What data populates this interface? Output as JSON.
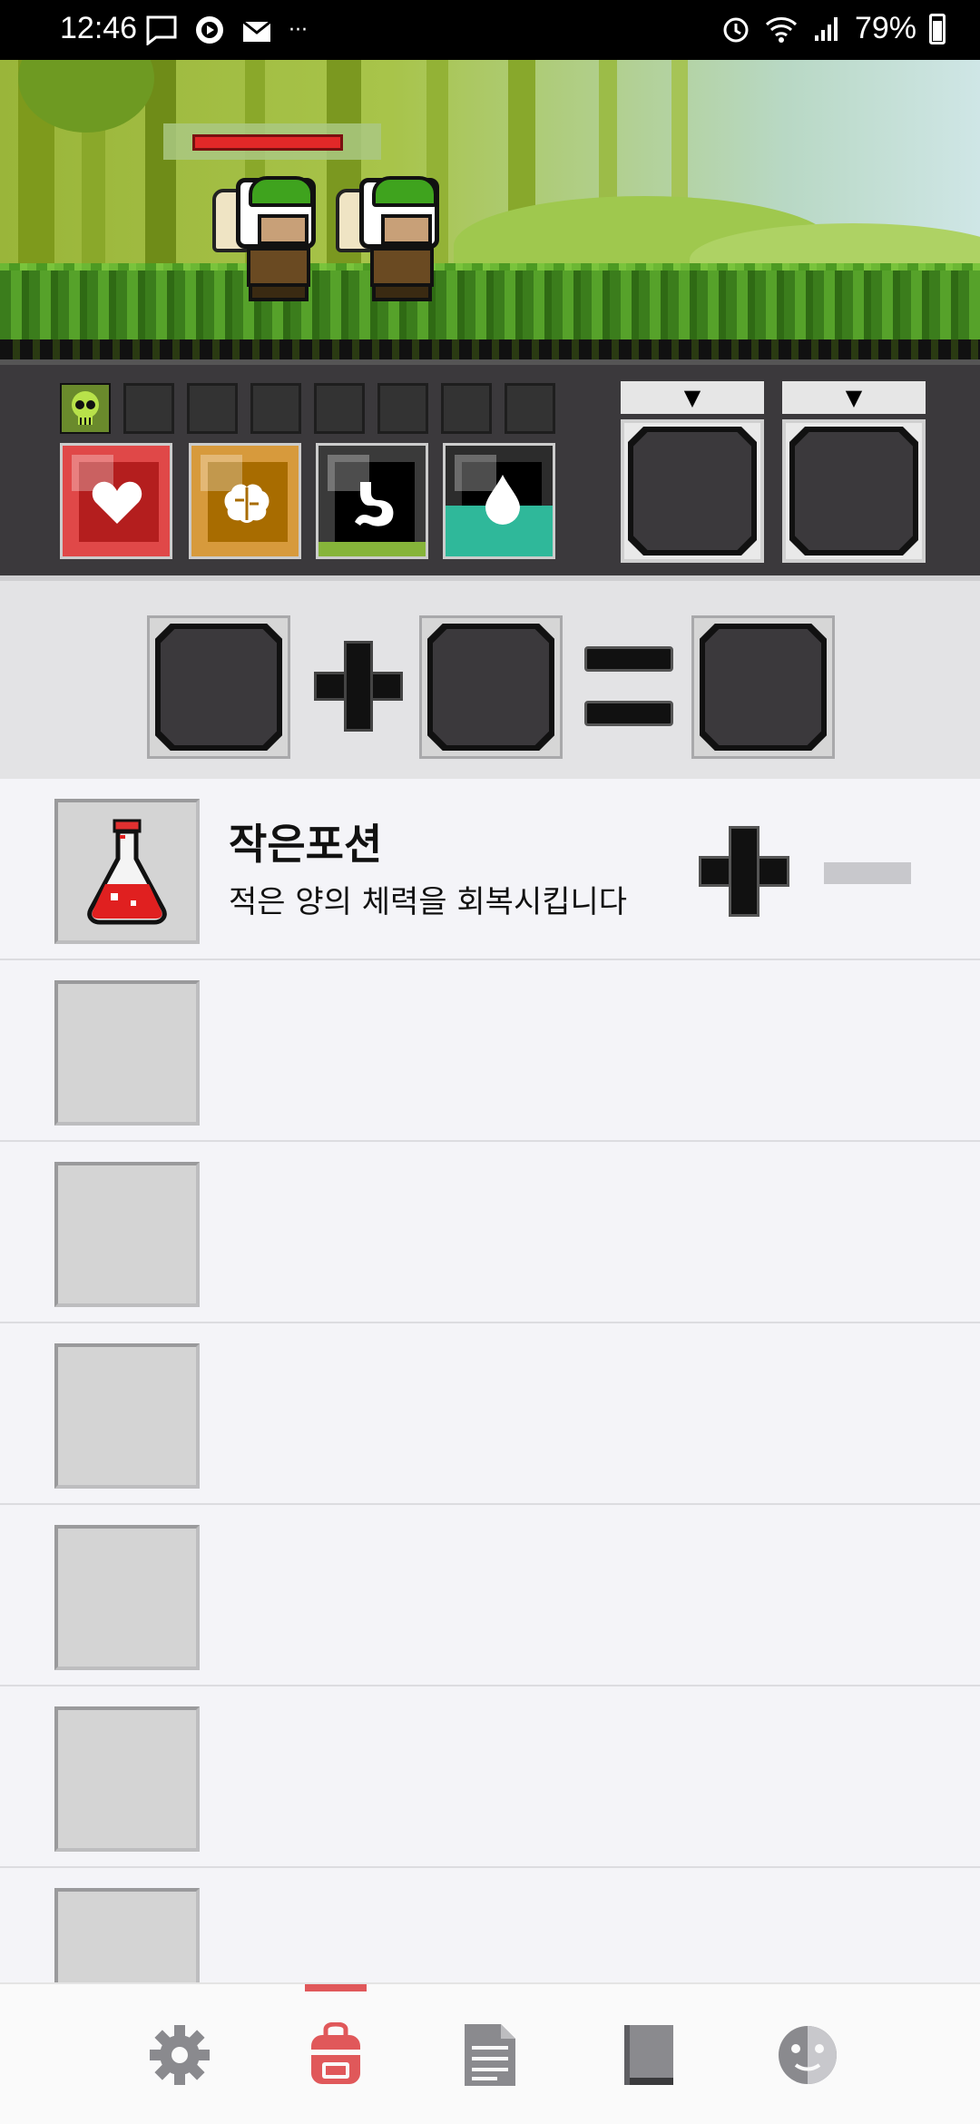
{
  "status_bar": {
    "time": "12:46",
    "left_icons": [
      "message-icon",
      "play-icon",
      "mail-icon",
      "more-dots-icon"
    ],
    "more": "···",
    "right_icons": [
      "alarm-icon",
      "wifi-icon",
      "signal-icon",
      "battery-icon"
    ],
    "battery": "79%"
  },
  "scene": {
    "enemy_count": 2,
    "enemy_hp_fraction": 1.0
  },
  "panel": {
    "buff_slots": 7,
    "stats": [
      {
        "name": "health",
        "icon": "heart-icon",
        "color": "#e04848"
      },
      {
        "name": "mind",
        "icon": "brain-icon",
        "color": "#d79a3c"
      },
      {
        "name": "hunger",
        "icon": "stomach-icon",
        "color": "#86b43a"
      },
      {
        "name": "thirst",
        "icon": "water-drop-icon",
        "color": "#2fb89a"
      }
    ],
    "equip_tab_arrow": "▼"
  },
  "combine": {
    "plus": "+",
    "equals": "="
  },
  "items": [
    {
      "name": "작은포션",
      "description": "적은 양의 체력을 회복시킵니다",
      "icon": "potion-flask-icon"
    },
    {
      "name": "",
      "description": ""
    },
    {
      "name": "",
      "description": ""
    },
    {
      "name": "",
      "description": ""
    },
    {
      "name": "",
      "description": ""
    },
    {
      "name": "",
      "description": ""
    },
    {
      "name": "",
      "description": ""
    }
  ],
  "nav": {
    "items": [
      {
        "icon": "gear-icon",
        "active": false
      },
      {
        "icon": "backpack-icon",
        "active": true
      },
      {
        "icon": "document-icon",
        "active": false
      },
      {
        "icon": "book-icon",
        "active": false
      },
      {
        "icon": "face-icon",
        "active": false
      }
    ],
    "active_color": "#e0585a",
    "inactive_color": "#8a8a8e"
  }
}
